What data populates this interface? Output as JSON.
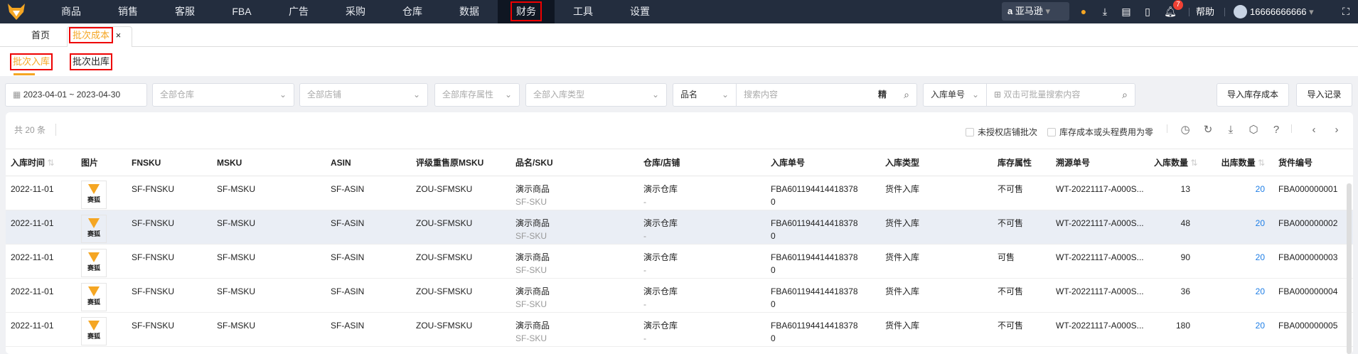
{
  "nav": {
    "items": [
      "商品",
      "销售",
      "客服",
      "FBA",
      "广告",
      "采购",
      "仓库",
      "数据",
      "财务",
      "工具",
      "设置"
    ],
    "active": "财务",
    "marketplace": "亚马逊",
    "notifications": "7",
    "help": "帮助",
    "user": "16666666666"
  },
  "tabs": {
    "home": "首页",
    "active": "批次成本",
    "close": "×"
  },
  "subtabs": {
    "inbound": "批次入库",
    "outbound": "批次出库"
  },
  "filters": {
    "date_range": "2023-04-01 ~ 2023-04-30",
    "warehouse": "全部仓库",
    "store": "全部店铺",
    "stock_attr": "全部库存属性",
    "inbound_type": "全部入库类型",
    "search_field": "品名",
    "search_placeholder": "搜索内容",
    "exact": "精",
    "order_field": "入库单号",
    "batch_placeholder": "双击可批量搜索内容",
    "import_cost": "导入库存成本",
    "import_log": "导入记录"
  },
  "toolbar": {
    "total": "共 20 条",
    "chk_unauthorized": "未授权店铺批次",
    "chk_zero_cost": "库存成本或头程费用为零"
  },
  "columns": [
    "入库时间",
    "图片",
    "FNSKU",
    "MSKU",
    "ASIN",
    "评级重售原MSKU",
    "品名/SKU",
    "仓库/店铺",
    "入库单号",
    "入库类型",
    "库存属性",
    "溯源单号",
    "入库数量",
    "出库数量",
    "货件编号"
  ],
  "rows": [
    {
      "date": "2022-11-01",
      "img": "赛狐",
      "fnsku": "SF-FNSKU",
      "msku": "SF-MSKU",
      "asin": "SF-ASIN",
      "regrade": "ZOU-SFMSKU",
      "name": "演示商品",
      "sku": "SF-SKU",
      "wh": "演示仓库",
      "store": "-",
      "order1": "FBA601194414418378",
      "order2": "0",
      "type": "货件入库",
      "attr": "不可售",
      "src": "WT-20221117-A000S...",
      "in": "13",
      "out": "20",
      "ship": "FBA000000001"
    },
    {
      "date": "2022-11-01",
      "img": "赛狐",
      "fnsku": "SF-FNSKU",
      "msku": "SF-MSKU",
      "asin": "SF-ASIN",
      "regrade": "ZOU-SFMSKU",
      "name": "演示商品",
      "sku": "SF-SKU",
      "wh": "演示仓库",
      "store": "-",
      "order1": "FBA601194414418378",
      "order2": "0",
      "type": "货件入库",
      "attr": "不可售",
      "src": "WT-20221117-A000S...",
      "in": "48",
      "out": "20",
      "ship": "FBA000000002"
    },
    {
      "date": "2022-11-01",
      "img": "赛狐",
      "fnsku": "SF-FNSKU",
      "msku": "SF-MSKU",
      "asin": "SF-ASIN",
      "regrade": "ZOU-SFMSKU",
      "name": "演示商品",
      "sku": "SF-SKU",
      "wh": "演示仓库",
      "store": "-",
      "order1": "FBA601194414418378",
      "order2": "0",
      "type": "货件入库",
      "attr": "可售",
      "src": "WT-20221117-A000S...",
      "in": "90",
      "out": "20",
      "ship": "FBA000000003"
    },
    {
      "date": "2022-11-01",
      "img": "赛狐",
      "fnsku": "SF-FNSKU",
      "msku": "SF-MSKU",
      "asin": "SF-ASIN",
      "regrade": "ZOU-SFMSKU",
      "name": "演示商品",
      "sku": "SF-SKU",
      "wh": "演示仓库",
      "store": "-",
      "order1": "FBA601194414418378",
      "order2": "0",
      "type": "货件入库",
      "attr": "不可售",
      "src": "WT-20221117-A000S...",
      "in": "36",
      "out": "20",
      "ship": "FBA000000004"
    },
    {
      "date": "2022-11-01",
      "img": "赛狐",
      "fnsku": "SF-FNSKU",
      "msku": "SF-MSKU",
      "asin": "SF-ASIN",
      "regrade": "ZOU-SFMSKU",
      "name": "演示商品",
      "sku": "SF-SKU",
      "wh": "演示仓库",
      "store": "-",
      "order1": "FBA601194414418378",
      "order2": "0",
      "type": "货件入库",
      "attr": "不可售",
      "src": "WT-20221117-A000S...",
      "in": "180",
      "out": "20",
      "ship": "FBA000000005"
    }
  ],
  "colors": {
    "nav_bg": "#232d3e",
    "accent": "#f5a623",
    "link": "#1e7ee6",
    "highlight": "#eaeef5"
  }
}
